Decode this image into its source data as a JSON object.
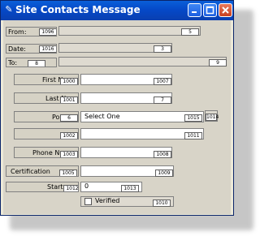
{
  "window": {
    "title": "Site Contacts Message"
  },
  "rows": {
    "from": {
      "label": "From:",
      "label_id": "1096",
      "field_id": "5"
    },
    "date": {
      "label": "Date:",
      "label_id": "1016",
      "field_id": "3"
    },
    "to": {
      "label": "To:",
      "label_id": "8",
      "field_id": "9"
    },
    "first_name": {
      "label": "First N",
      "label_id": "1000",
      "field_id": "1007"
    },
    "last_name": {
      "label": "Last N",
      "label_id": "1001",
      "field_id": "7"
    },
    "position": {
      "label": "Po",
      "label_id": "6",
      "select_value": "Select One",
      "field_id": "1015",
      "extra_id": "1014"
    },
    "unnamed": {
      "label_id": "1002",
      "field_id": "1011"
    },
    "phone": {
      "label": "Phone Nu",
      "label_id": "1003",
      "field_id": "1008"
    },
    "certification": {
      "label": "Certification",
      "label_id": "1005",
      "field_id": "1009"
    },
    "start": {
      "label": "Start",
      "label_id": "1012",
      "value": "0",
      "field_id": "1013"
    },
    "verified": {
      "label": "Verified",
      "field_id": "1010"
    }
  }
}
